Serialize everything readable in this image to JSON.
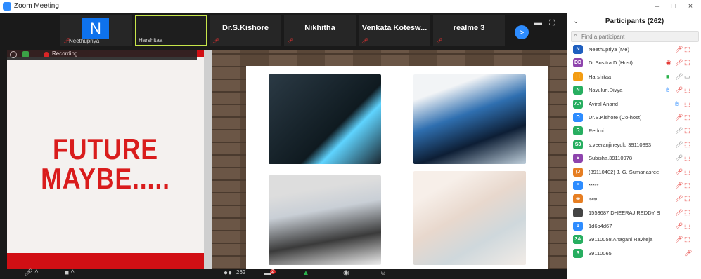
{
  "window": {
    "title": "Zoom Meeting",
    "minimize": "–",
    "maximize": "□",
    "close": "×"
  },
  "strip": {
    "tiles": [
      {
        "name": "Neethupriya",
        "avatar": "N",
        "muted": true,
        "selected": false
      },
      {
        "name": "Harshitaa",
        "avatar": "",
        "muted": false,
        "selected": true
      },
      {
        "name": "Dr.S.Kishore",
        "muted": true
      },
      {
        "name": "Nikhitha",
        "muted": true
      },
      {
        "name": "Venkata Kotesw...",
        "muted": true
      },
      {
        "name": "realme 3",
        "muted": true
      }
    ],
    "next_label": ">"
  },
  "recording": {
    "label": "Recording"
  },
  "slide": {
    "line1": "FUTURE",
    "line2": "MAYBE....."
  },
  "toolbar": {
    "participants_count": "262",
    "chat_badge": "2"
  },
  "participants": {
    "title": "Participants (262)",
    "search_placeholder": "Find a participant",
    "items": [
      {
        "initials": "N",
        "name": "Neethupriya (Me)",
        "color": "#1f5fbf",
        "icons": [
          "mic-muted",
          "video-off"
        ]
      },
      {
        "initials": "DD",
        "name": "Dr.Susitra D (Host)",
        "color": "#8e44ad",
        "icons": [
          "record",
          "mic-muted",
          "video-off"
        ]
      },
      {
        "initials": "H",
        "name": "Harshitaa",
        "color": "#f39c12",
        "icons": [
          "share",
          "mic",
          "video"
        ]
      },
      {
        "initials": "N",
        "name": "Navuluri.Divya",
        "color": "#27ae60",
        "icons": [
          "hand",
          "mic-muted",
          "video-off"
        ]
      },
      {
        "initials": "AA",
        "name": "Aviral Anand",
        "color": "#27ae60",
        "icons": [
          "hand",
          "video-off"
        ]
      },
      {
        "initials": "D",
        "name": "Dr.S.Kishore (Co-host)",
        "color": "#2d8cff",
        "icons": [
          "mic-muted",
          "video-off"
        ]
      },
      {
        "initials": "R",
        "name": "Redmi",
        "color": "#27ae60",
        "icons": [
          "mic",
          "video-off"
        ]
      },
      {
        "initials": "S3",
        "name": "s.veeranjineyulu 39110893",
        "color": "#27ae60",
        "icons": [
          "mic",
          "video-off"
        ]
      },
      {
        "initials": "S",
        "name": "Subisha.39110978",
        "color": "#8e44ad",
        "icons": [
          "mic",
          "video-off"
        ]
      },
      {
        "initials": "(J",
        "name": "(39110402) J. G. Sumanasree",
        "color": "#e67e22",
        "icons": [
          "mic-muted",
          "video-off"
        ]
      },
      {
        "initials": "*",
        "name": "*****",
        "color": "#2d8cff",
        "icons": [
          "mic-muted",
          "video-off"
        ]
      },
      {
        "initials": " అ",
        "name": "అఅ",
        "color": "#e67e22",
        "icons": [
          "mic-muted",
          "video-off"
        ]
      },
      {
        "initials": "",
        "name": "1553687 DHEERAJ REDDY B",
        "color": "#444444",
        "icons": [
          "mic-muted",
          "video-off"
        ]
      },
      {
        "initials": "1",
        "name": "1d6b4d67",
        "color": "#2d8cff",
        "icons": [
          "mic-muted",
          "video-off"
        ]
      },
      {
        "initials": "3A",
        "name": "39110058 Anagani Raviteja",
        "color": "#27ae60",
        "icons": [
          "mic-muted",
          "video-off"
        ]
      },
      {
        "initials": "3",
        "name": "39110065",
        "color": "#27ae60",
        "icons": [
          "mic-muted"
        ]
      }
    ]
  }
}
